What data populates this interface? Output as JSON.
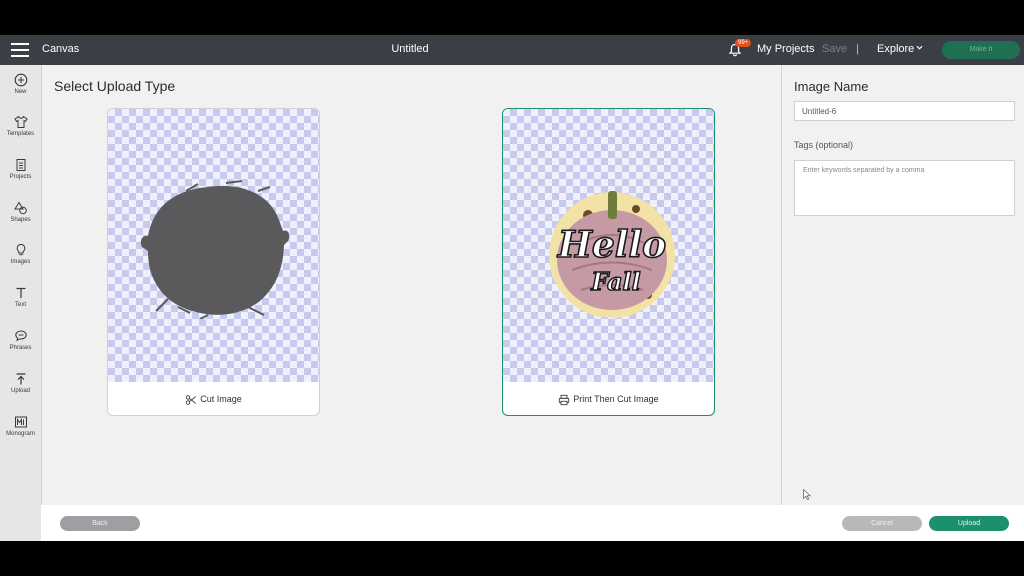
{
  "topbar": {
    "app_title": "Canvas",
    "doc_title": "Untitled",
    "notification_badge": "99+",
    "my_projects": "My Projects",
    "save": "Save",
    "separator": "|",
    "explore": "Explore",
    "make_it": "Make It"
  },
  "sidebar": {
    "items": [
      {
        "label": "New",
        "icon": "plus-circle-icon"
      },
      {
        "label": "Templates",
        "icon": "tshirt-icon"
      },
      {
        "label": "Projects",
        "icon": "projects-icon"
      },
      {
        "label": "Shapes",
        "icon": "shapes-icon"
      },
      {
        "label": "Images",
        "icon": "lightbulb-icon"
      },
      {
        "label": "Text",
        "icon": "text-icon"
      },
      {
        "label": "Phrases",
        "icon": "speech-bubble-icon"
      },
      {
        "label": "Upload",
        "icon": "upload-icon"
      },
      {
        "label": "Monogram",
        "icon": "monogram-icon"
      }
    ]
  },
  "main": {
    "heading": "Select Upload Type",
    "cards": [
      {
        "label": "Cut Image",
        "icon": "scissors-icon",
        "selected": false
      },
      {
        "label": "Print Then Cut Image",
        "icon": "printer-icon",
        "selected": true
      }
    ],
    "preview_text": {
      "line1": "Hello",
      "line2": "Fall"
    }
  },
  "right_panel": {
    "image_name_title": "Image Name",
    "image_name_value": "Untitled-6",
    "tags_label": "Tags (optional)",
    "tags_placeholder": "Enter keywords separated by a comma"
  },
  "bottom": {
    "back": "Back",
    "cancel": "Cancel",
    "upload": "Upload"
  },
  "colors": {
    "topbar": "#3b3f45",
    "accent": "#1c8f6e",
    "badge": "#e2501c"
  }
}
